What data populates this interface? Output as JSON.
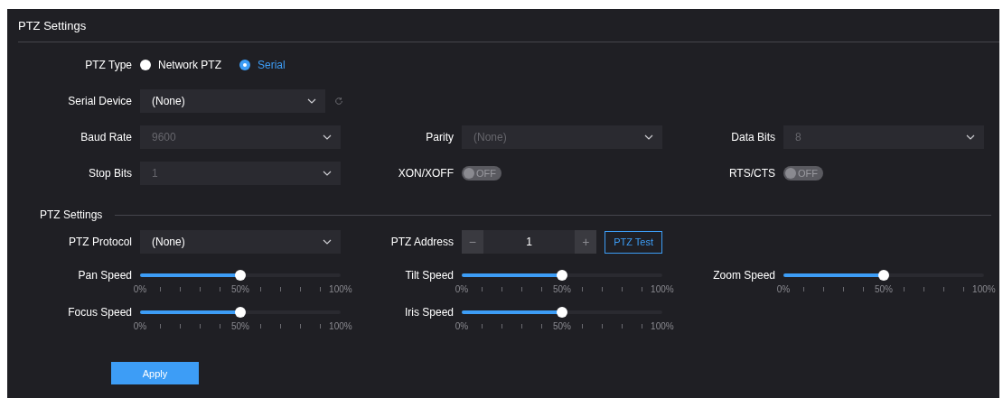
{
  "title": "PTZ Settings",
  "ptz_type": {
    "label": "PTZ Type",
    "options": [
      {
        "label": "Network PTZ",
        "selected": false
      },
      {
        "label": "Serial",
        "selected": true
      }
    ]
  },
  "serial_device": {
    "label": "Serial Device",
    "value": "(None)",
    "disabled": false
  },
  "port_fields": [
    {
      "kind": "select",
      "label": "Baud Rate",
      "value": "9600",
      "disabled": true
    },
    {
      "kind": "select",
      "label": "Parity",
      "value": "(None)",
      "disabled": true
    },
    {
      "kind": "select",
      "label": "Data Bits",
      "value": "8",
      "disabled": true
    },
    {
      "kind": "select",
      "label": "Stop Bits",
      "value": "1",
      "disabled": true
    },
    {
      "kind": "toggle",
      "label": "XON/XOFF",
      "on": false,
      "text": "OFF"
    },
    {
      "kind": "toggle",
      "label": "RTS/CTS",
      "on": false,
      "text": "OFF"
    }
  ],
  "ptz_section": {
    "title": "PTZ Settings",
    "protocol": {
      "label": "PTZ Protocol",
      "value": "(None)",
      "disabled": false
    },
    "address": {
      "label": "PTZ Address",
      "value": "1",
      "minus": "−",
      "plus": "+"
    },
    "test_button": "PTZ Test",
    "speeds": [
      {
        "label": "Pan Speed",
        "level": 0.5,
        "ticks": [
          "0%",
          "50%",
          "100%"
        ]
      },
      {
        "label": "Tilt Speed",
        "level": 0.5,
        "ticks": [
          "0%",
          "50%",
          "100%"
        ]
      },
      {
        "label": "Zoom Speed",
        "level": 0.5,
        "ticks": [
          "0%",
          "50%",
          "100%"
        ]
      },
      {
        "label": "Focus Speed",
        "level": 0.5,
        "ticks": [
          "0%",
          "50%",
          "100%"
        ]
      },
      {
        "label": "Iris Speed",
        "level": 0.5,
        "ticks": [
          "0%",
          "50%",
          "100%"
        ]
      }
    ]
  },
  "apply_button": "Apply"
}
